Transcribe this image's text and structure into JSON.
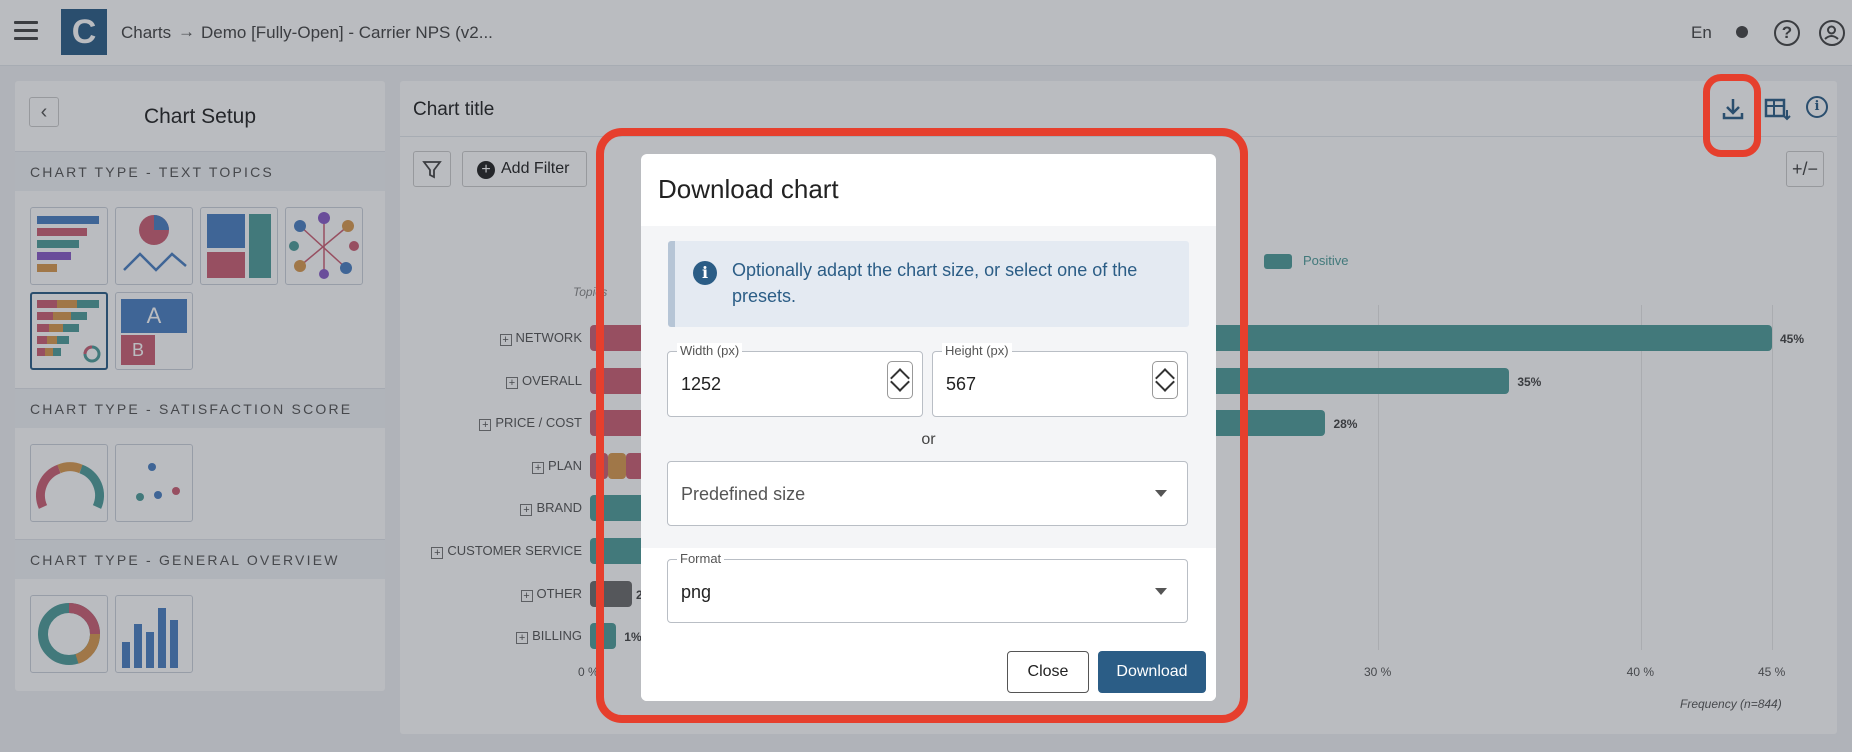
{
  "header": {
    "logo_letter": "C",
    "breadcrumb": [
      "Charts",
      "Demo [Fully-Open] - Carrier NPS (v2..."
    ],
    "breadcrumb_separator": "→",
    "language": "En",
    "help_glyph": "?"
  },
  "sidebar": {
    "back_glyph": "‹",
    "title": "Chart Setup",
    "sections": [
      {
        "title": "CHART TYPE - TEXT TOPICS"
      },
      {
        "title": "CHART TYPE - SATISFACTION SCORE"
      },
      {
        "title": "CHART TYPE - GENERAL OVERVIEW"
      }
    ],
    "thumbnail_letters": [
      "A",
      "B"
    ]
  },
  "main": {
    "chart_title": "Chart title",
    "add_filter_label": "Add Filter",
    "plus_glyph": "+",
    "toggle_glyph": "+/−",
    "legend": {
      "positive": "Positive"
    }
  },
  "chart_data": {
    "type": "bar",
    "orientation": "horizontal",
    "y_axis_label": "Topics",
    "x_axis_label": "Frequency (n=844)",
    "categories": [
      "NETWORK",
      "OVERALL",
      "PRICE / COST",
      "PLAN",
      "BRAND",
      "CUSTOMER SERVICE",
      "OTHER",
      "BILLING"
    ],
    "visible_value_labels": [
      "45%",
      "35%",
      "28%",
      "",
      "",
      "",
      "2",
      "1%"
    ],
    "series": [
      {
        "name": "Positive",
        "values": [
          45,
          35,
          28,
          null,
          null,
          null,
          null,
          1
        ]
      }
    ],
    "x_ticks": [
      "0 %",
      "30 %",
      "40 %",
      "45 %"
    ],
    "x_range": [
      0,
      45
    ],
    "colors": {
      "positive": "#4e9d9a",
      "negative": "#cc5f74",
      "neutral": "#d99a4e",
      "other": "#6b6b6b"
    }
  },
  "modal": {
    "title": "Download chart",
    "info_icon_glyph": "i",
    "info_text": "Optionally adapt the chart size, or select one of the presets.",
    "width_label": "Width (px)",
    "width_value": "1252",
    "height_label": "Height (px)",
    "height_value": "567",
    "or_text": "or",
    "predefined_placeholder": "Predefined size",
    "format_label": "Format",
    "format_value": "png",
    "close_label": "Close",
    "download_label": "Download"
  },
  "colors": {
    "brand": "#2b5d86",
    "highlight": "#e63f2d"
  }
}
